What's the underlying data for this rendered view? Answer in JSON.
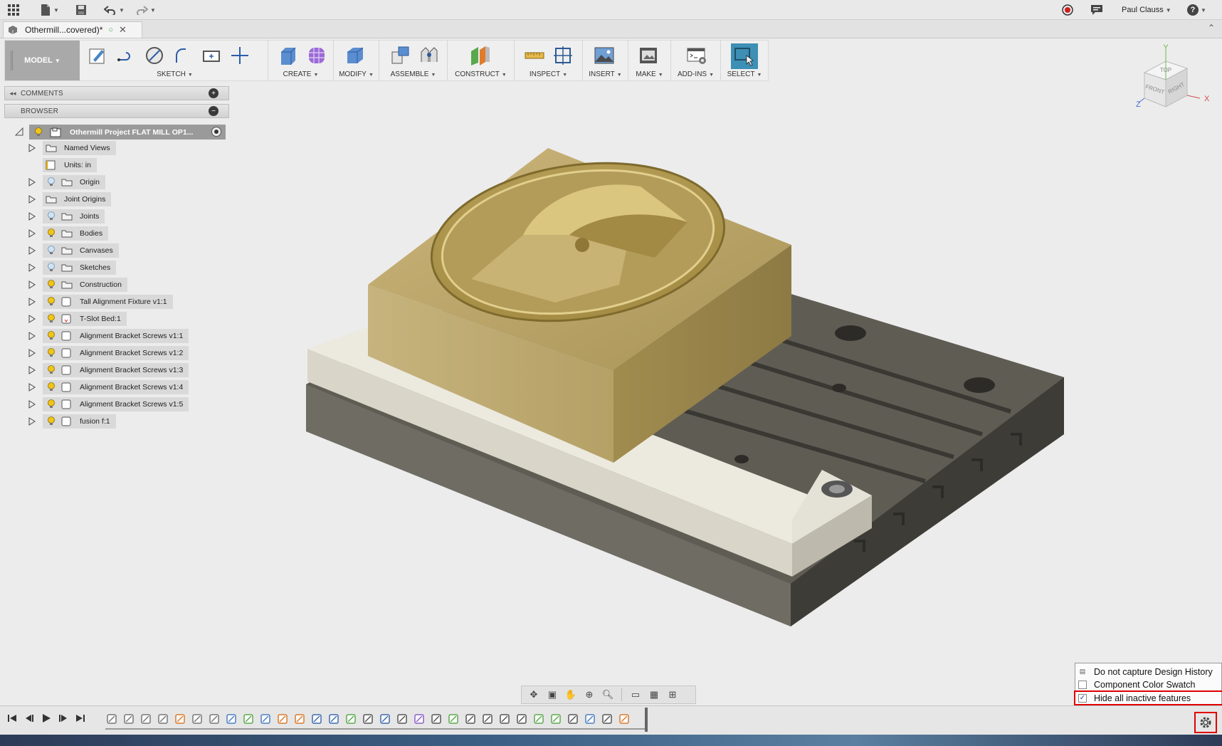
{
  "app": {
    "user_name": "Paul Clauss",
    "help_label": "?",
    "tab_title": "Othermill...covered)*"
  },
  "toolbar": {
    "model_label": "MODEL",
    "groups": [
      {
        "label": "SKETCH"
      },
      {
        "label": "CREATE"
      },
      {
        "label": "MODIFY"
      },
      {
        "label": "ASSEMBLE"
      },
      {
        "label": "CONSTRUCT"
      },
      {
        "label": "INSPECT"
      },
      {
        "label": "INSERT"
      },
      {
        "label": "MAKE"
      },
      {
        "label": "ADD-INS"
      },
      {
        "label": "SELECT"
      }
    ]
  },
  "panels": {
    "comments_label": "COMMENTS",
    "browser_label": "BROWSER"
  },
  "browser": {
    "root_label": "Othermill Project FLAT MILL OP1...",
    "items": [
      {
        "label": "Named Views",
        "bulb": "none",
        "icon": "folder"
      },
      {
        "label": "Units: in",
        "bulb": "none",
        "icon": "document"
      },
      {
        "label": "Origin",
        "bulb": "off",
        "icon": "folder"
      },
      {
        "label": "Joint Origins",
        "bulb": "none",
        "icon": "folder"
      },
      {
        "label": "Joints",
        "bulb": "off",
        "icon": "folder"
      },
      {
        "label": "Bodies",
        "bulb": "on",
        "icon": "folder"
      },
      {
        "label": "Canvases",
        "bulb": "off",
        "icon": "folder"
      },
      {
        "label": "Sketches",
        "bulb": "off",
        "icon": "folder"
      },
      {
        "label": "Construction",
        "bulb": "on",
        "icon": "folder"
      },
      {
        "label": "Tall Alignment Fixture v1:1",
        "bulb": "on",
        "icon": "component"
      },
      {
        "label": "T-Slot Bed:1",
        "bulb": "on",
        "icon": "component-linked"
      },
      {
        "label": "Alignment Bracket Screws v1:1",
        "bulb": "on",
        "icon": "component"
      },
      {
        "label": "Alignment Bracket Screws v1:2",
        "bulb": "on",
        "icon": "component"
      },
      {
        "label": "Alignment Bracket Screws v1:3",
        "bulb": "on",
        "icon": "component"
      },
      {
        "label": "Alignment Bracket Screws v1:4",
        "bulb": "on",
        "icon": "component"
      },
      {
        "label": "Alignment Bracket Screws v1:5",
        "bulb": "on",
        "icon": "component"
      },
      {
        "label": "fusion f:1",
        "bulb": "on",
        "icon": "component"
      }
    ]
  },
  "viewcube": {
    "top": "TOP",
    "front": "FRONT",
    "right": "RIGHT",
    "axis_x": "X",
    "axis_y": "Y",
    "axis_z": "Z"
  },
  "settings_popup": {
    "options": [
      {
        "label": "Do not capture Design History",
        "checked": false
      },
      {
        "label": "Component Color Swatch",
        "checked": false
      },
      {
        "label": "Hide all inactive features",
        "checked": true
      }
    ]
  },
  "colors": {
    "accent_select": "#3d8fb5",
    "highlight_red": "#e00000",
    "stock_gold": "#b8a266",
    "bed_dark": "#4a4842",
    "bracket_light": "#d8d4c6"
  }
}
